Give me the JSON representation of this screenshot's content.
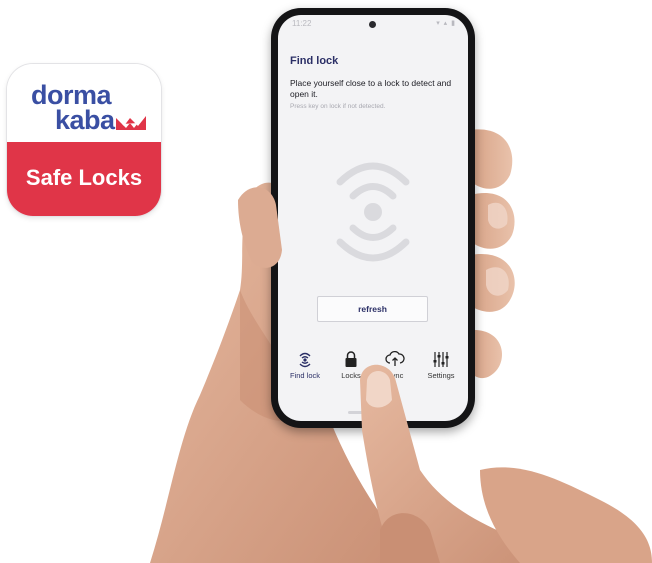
{
  "app_icon": {
    "brand_line1": "dorma",
    "brand_line2": "kaba",
    "app_name": "Safe Locks",
    "colors": {
      "brand_blue": "#3a4fa3",
      "brand_red": "#e03548"
    }
  },
  "phone": {
    "status_time": "11:22",
    "status_icons": "▾ ▴ ▮",
    "screen": {
      "title": "Find lock",
      "instruction": "Place yourself close to a lock to detect and open it.",
      "hint": "Press key on lock if not detected.",
      "refresh_label": "refresh",
      "signal_icon": "signal-waves-icon"
    },
    "tabs": [
      {
        "label": "Find lock",
        "icon": "find-lock-icon",
        "active": true
      },
      {
        "label": "Locks",
        "icon": "padlock-icon",
        "active": false
      },
      {
        "label": "Sync",
        "icon": "cloud-sync-icon",
        "active": false
      },
      {
        "label": "Settings",
        "icon": "sliders-icon",
        "active": false
      }
    ],
    "colors": {
      "accent": "#2b2f66",
      "screen_bg": "#f3f3f5"
    }
  }
}
